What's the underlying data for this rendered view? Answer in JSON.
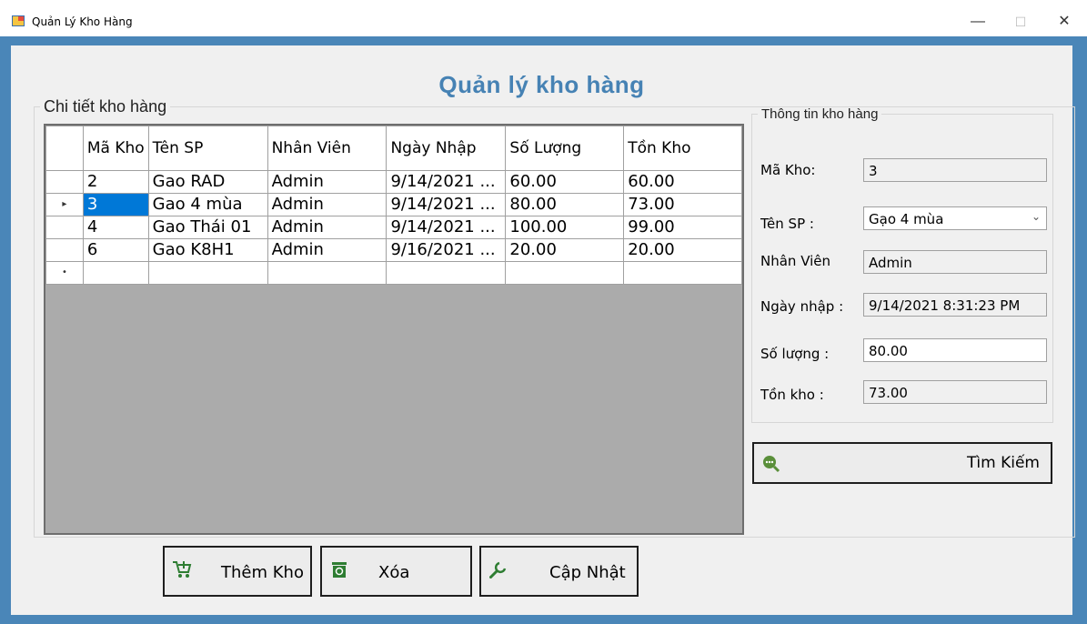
{
  "window": {
    "title": "Quản Lý Kho Hàng",
    "minimize": "—",
    "maximize": "☐",
    "close": "✕"
  },
  "heading": "Quản lý kho hàng",
  "grid_group": {
    "legend": "Chi tiết kho hàng"
  },
  "grid": {
    "columns": [
      "Mã Kho",
      "Tên SP",
      "Nhân Viên",
      "Ngày Nhập",
      "Số Lượng",
      "Tồn Kho"
    ],
    "rows": [
      [
        "2",
        "Gao RAD",
        "Admin",
        "9/14/2021 ...",
        "60.00",
        "60.00"
      ],
      [
        "3",
        "Gao 4 mùa",
        "Admin",
        "9/14/2021 ...",
        "80.00",
        "73.00"
      ],
      [
        "4",
        "Gao Thái 01",
        "Admin",
        "9/14/2021 ...",
        "100.00",
        "99.00"
      ],
      [
        "6",
        "Gao K8H1",
        "Admin",
        "9/16/2021 ...",
        "20.00",
        "20.00"
      ]
    ],
    "current_row_marker": "▸",
    "new_row_marker": "•"
  },
  "detail_group": {
    "legend": "Thông tin kho hàng"
  },
  "form": {
    "ma_kho_label": "Mã Kho:",
    "ma_kho_value": "3",
    "ten_sp_label": "Tên SP :",
    "ten_sp_value": "Gạo 4 mùa",
    "nhan_vien_label": "Nhân Viên",
    "nhan_vien_value": "Admin",
    "ngay_nhap_label": "Ngày nhập :",
    "ngay_nhap_value": "9/14/2021 8:31:23 PM",
    "so_luong_label": "Số lượng :",
    "so_luong_value": "80.00",
    "ton_kho_label": "Tồn kho :",
    "ton_kho_value": "73.00"
  },
  "buttons": {
    "search": "Tìm Kiếm",
    "add": "Thêm Kho",
    "delete": "Xóa",
    "update": "Cập Nhật"
  },
  "colors": {
    "accent": "#4682b4",
    "frame": "#4a86b8",
    "selection": "#0078d7",
    "icon_green": "#2e7d32"
  }
}
